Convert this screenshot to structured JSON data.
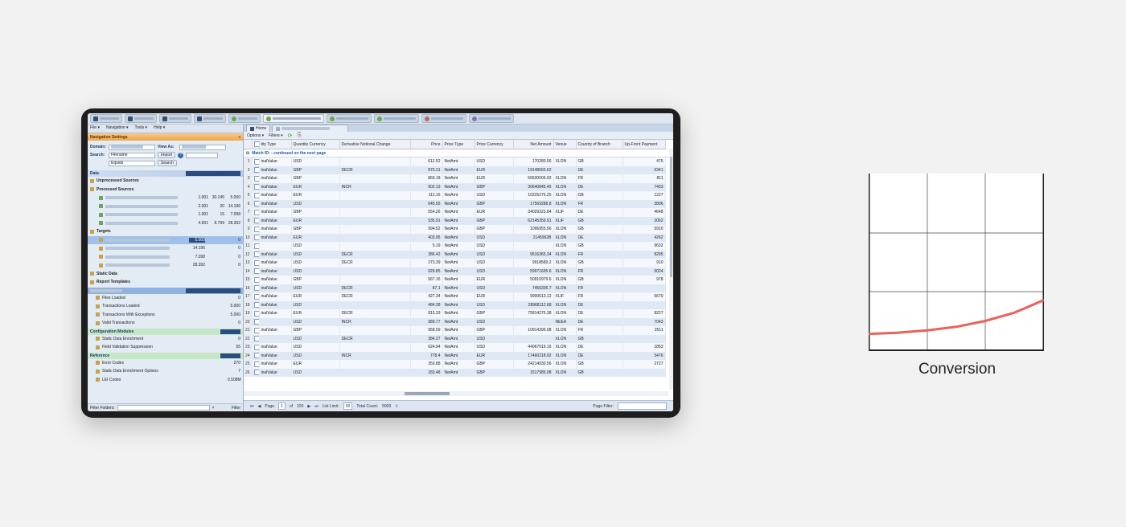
{
  "browser_tabs": [
    "",
    "",
    "",
    "",
    "",
    "",
    "",
    "",
    "",
    ""
  ],
  "menu": [
    "File ▾",
    "Navigation ▾",
    "Tools ▾",
    "Help ▾"
  ],
  "nav_settings": {
    "title": "Navigation Settings",
    "domain_label": "Domain:",
    "view_as_label": "View As:",
    "search_label": "Search:",
    "search_field": "Filename",
    "search_op": "Equals",
    "import_button": "Import",
    "search_button": "Search"
  },
  "tree": {
    "data": "Data",
    "unprocessed": "Unprocessed Sources",
    "processed": "Processed Sources",
    "processed_rows": [
      [
        "1.001",
        "30.145",
        "5.000"
      ],
      [
        "2.001",
        "20",
        "14.196"
      ],
      [
        "1.001",
        "15",
        "7.098"
      ],
      [
        "4.001",
        "8.799",
        "28.392"
      ]
    ],
    "targets": "Targets",
    "target_rows": [
      "5.000",
      "14.196",
      "7.098",
      "28.392"
    ],
    "target_vals": [
      "0",
      "0",
      "0",
      "0"
    ],
    "static_data": "Static Data",
    "report_templates": "Report Templates",
    "summary_items": [
      {
        "label": "Files Loaded",
        "value": "0"
      },
      {
        "label": "Transactions Loaded",
        "value": "5.000"
      },
      {
        "label": "Transactions With Exceptions",
        "value": "5.000"
      },
      {
        "label": "Valid Transactions",
        "value": "0"
      }
    ],
    "config_modules": "Configuration Modules",
    "config_items": [
      {
        "label": "Static Data Enrichment",
        "value": "0"
      },
      {
        "label": "Field Validation Suppression",
        "value": "55"
      }
    ],
    "reference": "Reference",
    "reference_items": [
      {
        "label": "Error Codes",
        "value": "270"
      },
      {
        "label": "Static Data Enrichment Options",
        "value": "7"
      },
      {
        "label": "LEI Codes",
        "value": "0.508M"
      }
    ],
    "filter_folders_label": "Filter Folders:",
    "filter_button": "Filter"
  },
  "main": {
    "tabs": [
      "Home",
      ""
    ],
    "toolbar": [
      "Options ▾",
      "Filters ▾"
    ],
    "columns": [
      "tity Type",
      "Quantity Currency",
      "Derivative Notional Change",
      "Price",
      "Price Type",
      "Price Currency",
      "Net Amount",
      "Venue",
      "Country of Branch",
      "Up-Front Payment"
    ],
    "group_label": "Match ID: - continued on the next page",
    "rows": [
      [
        "1",
        "inalValue",
        "USD",
        "",
        "612.52",
        "NetAmt",
        "USD",
        "170280.56",
        "XLON",
        "GB",
        "475"
      ],
      [
        "2",
        "inalValue",
        "GBP",
        "DECR",
        "870.31",
        "NetAmt",
        "EUR",
        "19148560.62",
        "",
        "DE",
        "6341"
      ],
      [
        "3",
        "inalValue",
        "GBP",
        "",
        "869.18",
        "NetAmt",
        "EUR",
        "56630006.92",
        "XLON",
        "FR",
        "811"
      ],
      [
        "4",
        "inalValue",
        "EUR",
        "INCR",
        "902.13",
        "NetAmt",
        "GBP",
        "30640845.45",
        "XLON",
        "DE",
        "7403"
      ],
      [
        "5",
        "inalValue",
        "EUR",
        "",
        "112.15",
        "NetAmt",
        "USD",
        "10225276.25",
        "XLON",
        "GB",
        "1227"
      ],
      [
        "6",
        "inalValue",
        "USD",
        "",
        "645.55",
        "NetAmt",
        "GBP",
        "17569288.8",
        "XLON",
        "FR",
        "3896"
      ],
      [
        "7",
        "inalValue",
        "GBP",
        "",
        "554.26",
        "NetAmt",
        "EUR",
        "34029323.84",
        "XLIF",
        "DE",
        "4648"
      ],
      [
        "8",
        "inalValue",
        "EUR",
        "",
        "935.91",
        "NetAmt",
        "GBP",
        "62145359.91",
        "XLIF",
        "GB",
        "3062"
      ],
      [
        "9",
        "inalValue",
        "GBP",
        "",
        "994.52",
        "NetAmt",
        "GBP",
        "1096955.56",
        "XLON",
        "GB",
        "5910"
      ],
      [
        "10",
        "inalValue",
        "EUR",
        "",
        "403.95",
        "NetAmt",
        "USD",
        "2145962B",
        "XLON",
        "DE",
        "4262"
      ],
      [
        "11",
        "",
        "USD",
        "",
        "5.19",
        "NetAmt",
        "USD",
        "",
        "XLON",
        "GB",
        "9632"
      ],
      [
        "12",
        "inalValue",
        "USD",
        "DECR",
        "386.42",
        "NetAmt",
        "USD",
        "9516365.34",
        "XLON",
        "FR",
        "8295"
      ],
      [
        "13",
        "inalValue",
        "USD",
        "DECR",
        "273.39",
        "NetAmt",
        "USD",
        "9918589.2",
        "XLON",
        "GB",
        "910"
      ],
      [
        "14",
        "inalValue",
        "USD",
        "",
        "929.85",
        "NetAmt",
        "USD",
        "59971605.6",
        "XLON",
        "FR",
        "9024"
      ],
      [
        "15",
        "inalValue",
        "GBP",
        "",
        "567.16",
        "NetAmt",
        "EUR",
        "50910979.6",
        "XLON",
        "GB",
        "978"
      ],
      [
        "16",
        "inalValue",
        "USD",
        "DECR",
        "87.1",
        "NetAmt",
        "USD",
        "7456336.7",
        "XLON",
        "FR",
        ""
      ],
      [
        "17",
        "inalValue",
        "EUR",
        "DECR",
        "427.34",
        "NetAmt",
        "EUR",
        "9900613.12",
        "XLIF",
        "FR",
        "6670"
      ],
      [
        "18",
        "inalValue",
        "USD",
        "",
        "484.28",
        "NetAmt",
        "USD",
        "28968112.68",
        "XLON",
        "DE",
        ""
      ],
      [
        "19",
        "inalValue",
        "EUR",
        "DECR",
        "815.33",
        "NetAmt",
        "GBP",
        "75814275.38",
        "XLON",
        "DE",
        "8227"
      ],
      [
        "20",
        "",
        "USD",
        "INCR",
        "989.77",
        "NetAmt",
        "USD",
        "",
        "NEEA",
        "DE",
        "7043"
      ],
      [
        "21",
        "inalValue",
        "GBP",
        "",
        "958.59",
        "NetAmt",
        "GBP",
        "10914396.08",
        "XLON",
        "FR",
        "2511"
      ],
      [
        "22",
        "",
        "USD",
        "DECR",
        "384.27",
        "NetAmt",
        "USD",
        "",
        "XLON",
        "GB",
        ""
      ],
      [
        "23",
        "inalValue",
        "USD",
        "",
        "624.94",
        "NetAmt",
        "USD",
        "44067019.16",
        "XLON",
        "DE",
        "1853"
      ],
      [
        "24",
        "inalValue",
        "USD",
        "INCR",
        "778.4",
        "NetAmt",
        "EUR",
        "17460218.92",
        "XLON",
        "DE",
        "5476"
      ],
      [
        "25",
        "inalValue",
        "EUR",
        "",
        "350.88",
        "NetAmt",
        "GBP",
        "24214930.56",
        "XLON",
        "GB",
        "2727"
      ],
      [
        "26",
        "inalValue",
        "USD",
        "",
        "183.48",
        "NetAmt",
        "GBP",
        "1517985.08",
        "XLON",
        "GB",
        ""
      ]
    ],
    "pager": {
      "page_label": "Page",
      "page": "1",
      "of_label": "of",
      "total_pages": "100",
      "list_limit_label": "List Limit:",
      "list_limit": "50",
      "total_count_label": "Total Count:",
      "total_count": "5000",
      "page_filter_label": "Page Filter:"
    }
  },
  "chart_data": {
    "type": "line",
    "title": "Conversion",
    "xlabel": "",
    "ylabel": "",
    "grid": true,
    "x": [
      0,
      0.5,
      1,
      1.5,
      2,
      2.5,
      3
    ],
    "series": [
      {
        "values": [
          0.28,
          0.3,
          0.34,
          0.4,
          0.5,
          0.64,
          0.85
        ]
      }
    ],
    "xlim": [
      0,
      3
    ],
    "ylim": [
      0,
      3
    ],
    "line_color": "#e8625a"
  }
}
